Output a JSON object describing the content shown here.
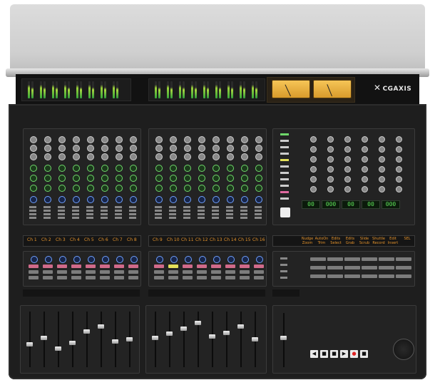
{
  "brand": {
    "logo_text": "CGAXIS",
    "logo_mark": "✕"
  },
  "channel_labels_left": [
    "Ch 1",
    "Ch 2",
    "Ch 3",
    "Ch 4",
    "Ch 5",
    "Ch 6",
    "Ch 7",
    "Ch 8"
  ],
  "channel_labels_right": [
    "Ch 9",
    "Ch 10",
    "Ch 11",
    "Ch 12",
    "Ch 13",
    "Ch 14",
    "Ch 15",
    "Ch 16"
  ],
  "function_labels": [
    {
      "top": "Nudge",
      "bottom": "Zoom"
    },
    {
      "top": "AutoOn",
      "bottom": "Trim"
    },
    {
      "top": "Edits",
      "bottom": "Select"
    },
    {
      "top": "Edits",
      "bottom": "Grab"
    },
    {
      "top": "Slide",
      "bottom": "Scrub"
    },
    {
      "top": "Shuttle",
      "bottom": "Record"
    },
    {
      "top": "Edit",
      "bottom": "Insert"
    },
    {
      "top": "SEL",
      "bottom": ""
    }
  ],
  "timecode_digits": [
    "00",
    "000",
    "00",
    "00",
    "000"
  ],
  "transport": {
    "play_symbol": "▶",
    "stop_symbol": "■",
    "rec_symbol": "●"
  },
  "colors": {
    "meter_green": "#37a83a",
    "vu_amber": "#f6c557",
    "label_orange": "#e4932c",
    "lcd_green": "#5fe35a"
  }
}
